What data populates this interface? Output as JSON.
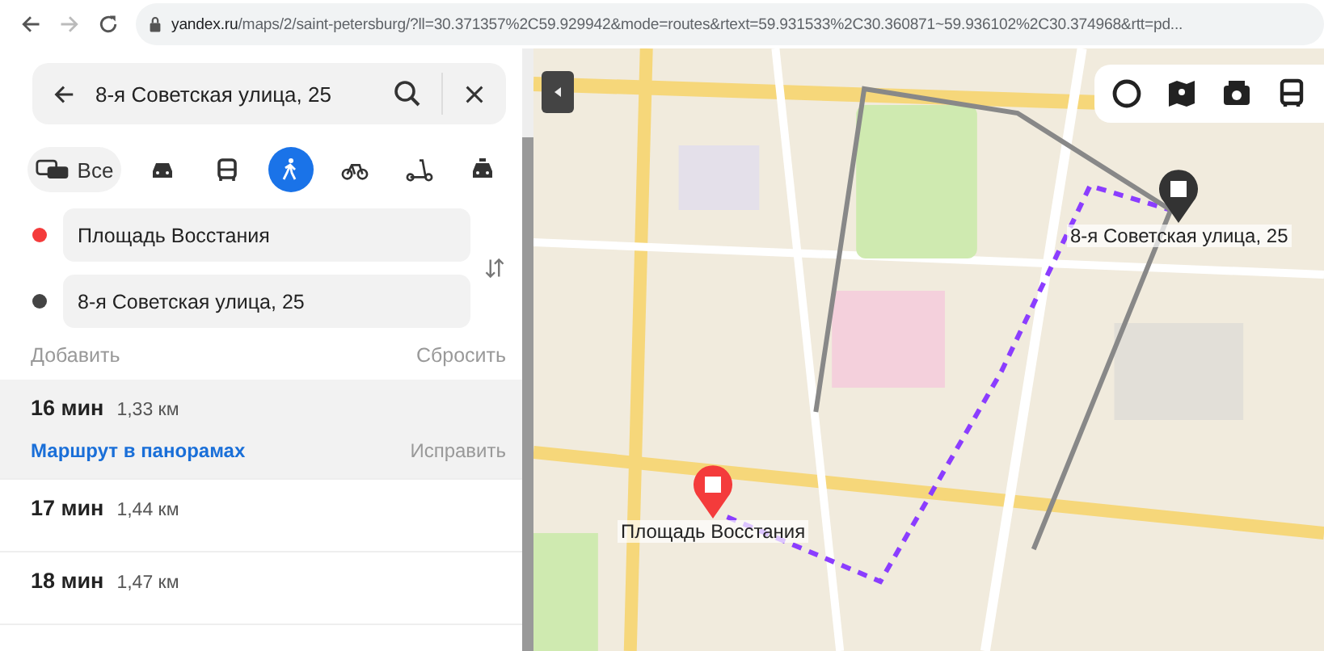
{
  "browser": {
    "url_host": "yandex.ru",
    "url_rest": "/maps/2/saint-petersburg/?ll=30.371357%2C59.929942&mode=routes&rtext=59.931533%2C30.360871~59.936102%2C30.374968&rtt=pd..."
  },
  "search": {
    "value": "8-я Советская улица, 25"
  },
  "modes": [
    {
      "kind": "all",
      "label": "Все",
      "selected": false
    },
    {
      "kind": "car",
      "selected": false
    },
    {
      "kind": "bus",
      "selected": false
    },
    {
      "kind": "walk",
      "selected": true
    },
    {
      "kind": "bike",
      "selected": false
    },
    {
      "kind": "scooter",
      "selected": false
    },
    {
      "kind": "taxi",
      "selected": false
    }
  ],
  "points": [
    {
      "value": "Площадь Восстания",
      "color": "#f43b3b"
    },
    {
      "value": "8-я Советская улица, 25",
      "color": "#444444"
    }
  ],
  "add_label": "Добавить",
  "reset_label": "Сбросить",
  "routes": [
    {
      "time": "16 мин",
      "distance": "1,33 км",
      "selected": true,
      "link": "Маршрут в панорамах",
      "fix": "Исправить"
    },
    {
      "time": "17 мин",
      "distance": "1,44 км",
      "selected": false
    },
    {
      "time": "18 мин",
      "distance": "1,47 км",
      "selected": false
    }
  ],
  "map": {
    "markers": [
      {
        "kind": "start",
        "label": "Площадь Восстания"
      },
      {
        "kind": "end",
        "label": "8-я Советская улица, 25"
      }
    ]
  }
}
